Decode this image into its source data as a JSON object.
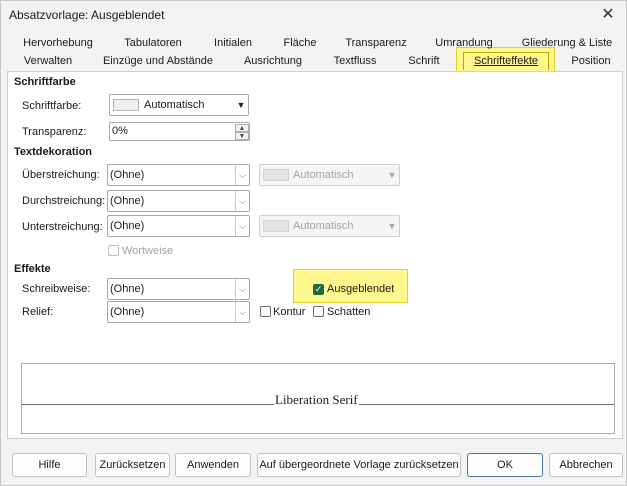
{
  "window": {
    "title": "Absatzvorlage: Ausgeblendet",
    "close_icon": "close-icon"
  },
  "tabs_row1": [
    "Hervorhebung",
    "Tabulatoren",
    "Initialen",
    "Fläche",
    "Transparenz",
    "Umrandung",
    "Gliederung & Liste"
  ],
  "tabs_row2": [
    "Verwalten",
    "Einzüge und Abstände",
    "Ausrichtung",
    "Textfluss",
    "Schrift",
    "Schrifteffekte",
    "Position"
  ],
  "active_tab": "Schrifteffekte",
  "font_color": {
    "section": "Schriftfarbe",
    "color_label": "Schriftfarbe:",
    "color_value": "Automatisch",
    "transparency_label": "Transparenz:",
    "transparency_value": "0%"
  },
  "text_decoration": {
    "section": "Textdekoration",
    "overline_label": "Überstreichung:",
    "overline_value": "(Ohne)",
    "overline_color": "Automatisch",
    "strikethrough_label": "Durchstreichung:",
    "strikethrough_value": "(Ohne)",
    "underline_label": "Unterstreichung:",
    "underline_value": "(Ohne)",
    "underline_color": "Automatisch",
    "word_by_word": "Wortweise"
  },
  "effects": {
    "section": "Effekte",
    "case_label": "Schreibweise:",
    "case_value": "(Ohne)",
    "relief_label": "Relief:",
    "relief_value": "(Ohne)",
    "hidden_label": "Ausgeblendet",
    "hidden_checked": true,
    "outline_label": "Kontur",
    "shadow_label": "Schatten"
  },
  "preview": {
    "text": "Liberation Serif"
  },
  "buttons": {
    "help": "Hilfe",
    "reset": "Zurücksetzen",
    "apply": "Anwenden",
    "reset_parent": "Auf übergeordnete Vorlage zurücksetzen",
    "ok": "OK",
    "cancel": "Abbrechen"
  },
  "highlight_color": "#fff78e"
}
